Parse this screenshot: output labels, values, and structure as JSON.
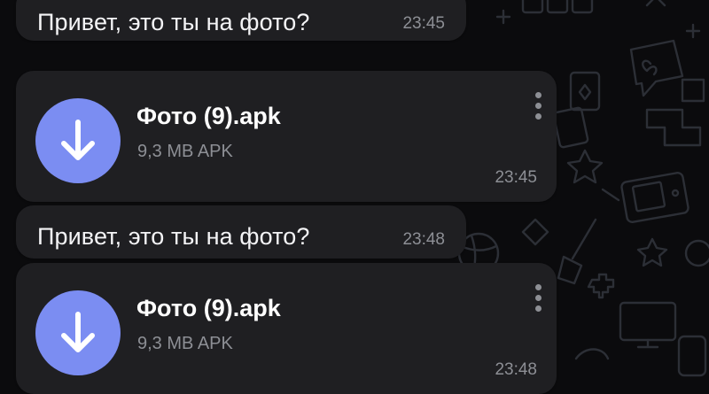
{
  "messages": [
    {
      "text": "Привет, это ты на фото?",
      "time": "23:45"
    },
    {
      "file_name": "Фото (9).apk",
      "file_info": "9,3 MB APK",
      "time": "23:45",
      "icon": "download-arrow-icon"
    },
    {
      "text": "Привет, это ты на фото?",
      "time": "23:48"
    },
    {
      "file_name": "Фото (9).apk",
      "file_info": "9,3 MB APK",
      "time": "23:48",
      "icon": "download-arrow-icon"
    }
  ],
  "colors": {
    "background": "#0b0b0d",
    "bubble": "#1f1f22",
    "accent": "#7b8df2",
    "text": "#f4f4f6",
    "secondary_text": "#8d8f95"
  }
}
